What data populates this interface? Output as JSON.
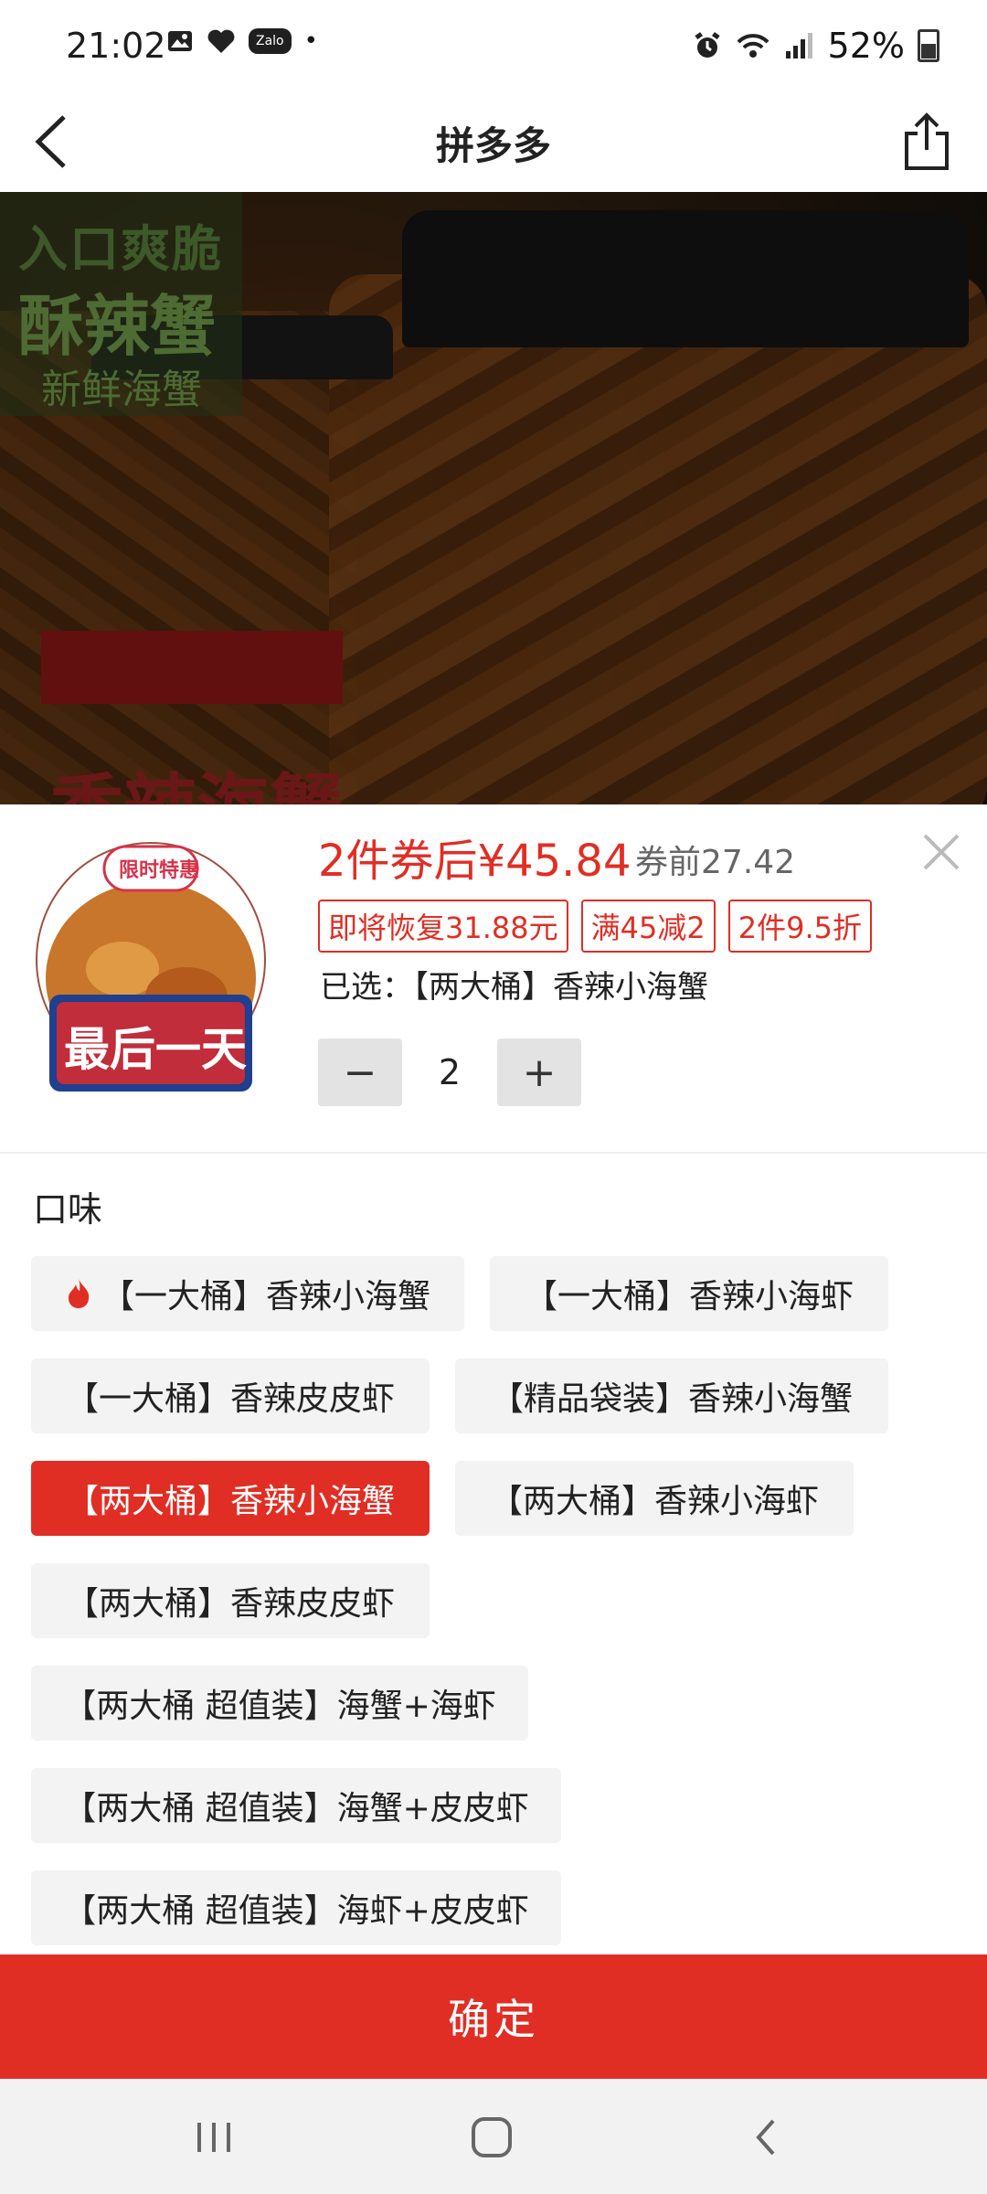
{
  "status_bar": {
    "time": "21:02",
    "zalo": "Zalo",
    "dot": "•",
    "battery": "52%"
  },
  "nav": {
    "title": "拼多多"
  },
  "hero": {
    "line1": "入口爽脆",
    "line2": "酥辣蟹",
    "line3": "新鲜海蟹",
    "line4": "香辣海蟹"
  },
  "thumb": {
    "badge": "限时特惠",
    "banner": "最后一天"
  },
  "product": {
    "price": "2件券后¥45.84",
    "price_before": "券前27.42",
    "tags": [
      "即将恢复31.88元",
      "满45减2",
      "2件9.5折"
    ],
    "selected_prefix": "已选：",
    "selected_value": "【两大桶】香辣小海蟹",
    "quantity": "2",
    "minus": "−",
    "plus": "+"
  },
  "flavor": {
    "title": "口味",
    "options": [
      "【一大桶】香辣小海蟹",
      "【一大桶】香辣小海虾",
      "【一大桶】香辣皮皮虾",
      "【精品袋装】香辣小海蟹",
      "【两大桶】香辣小海蟹",
      "【两大桶】香辣小海虾",
      "【两大桶】香辣皮皮虾",
      "【两大桶 超值装】海蟹+海虾",
      "【两大桶 超值装】海蟹+皮皮虾",
      "【两大桶 超值装】海虾+皮皮虾"
    ],
    "selected_index": 4
  },
  "confirm_label": "确定",
  "colors": {
    "accent": "#e02e24",
    "option_bg": "#f3f3f3"
  },
  "icons": [
    "back-icon",
    "share-icon",
    "close-icon",
    "flame-icon",
    "gallery-icon",
    "heart-icon",
    "alarm-icon",
    "wifi-icon",
    "signal-icon",
    "battery-icon"
  ]
}
